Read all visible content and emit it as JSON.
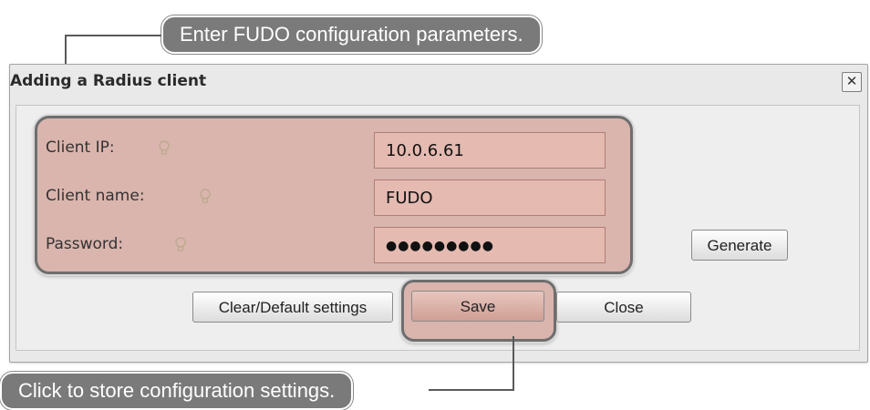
{
  "callouts": {
    "top": "Enter FUDO configuration parameters.",
    "bottom": "Click to store configuration settings."
  },
  "dialog": {
    "title": "Adding a Radius client",
    "close_glyph": "✕",
    "fields": {
      "client_ip_label": "Client IP:",
      "client_ip_value": "10.0.6.61",
      "client_name_label": "Client name:",
      "client_name_value": "FUDO",
      "password_label": "Password:",
      "password_value": "●●●●●●●●●"
    },
    "buttons": {
      "generate": "Generate",
      "clear_default": "Clear/Default settings",
      "save": "Save",
      "close": "Close"
    }
  },
  "icons": {
    "hint": "lightbulb-icon",
    "close": "close-icon"
  },
  "colors": {
    "highlight": "#c98678",
    "callout_bg": "#7a7a7a"
  }
}
